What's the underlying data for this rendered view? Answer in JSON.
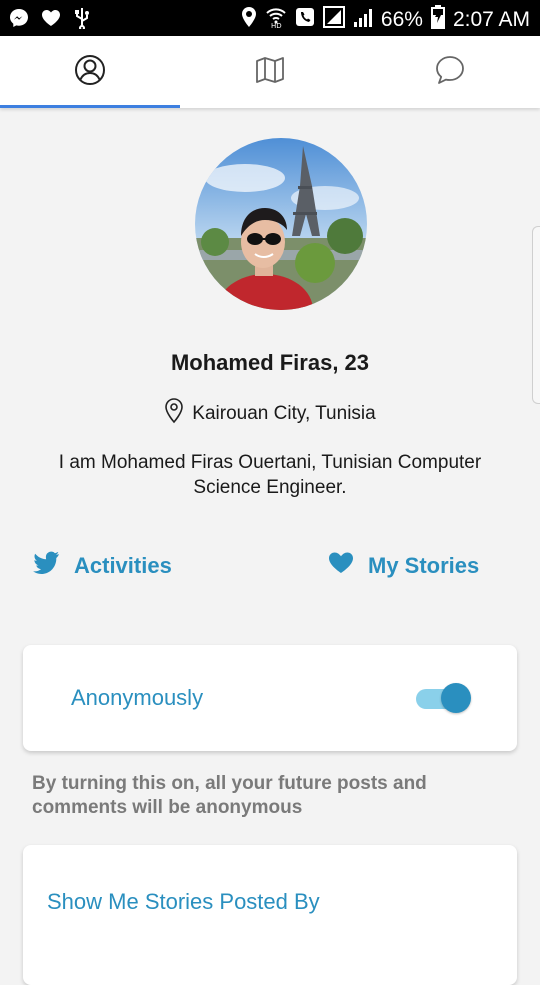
{
  "status_bar": {
    "battery": "66%",
    "time": "2:07 AM",
    "left_icons": [
      "messenger-icon",
      "heart-icon",
      "usb-icon"
    ],
    "right_icons": [
      "location-icon",
      "wifi-calling-icon",
      "phone-icon",
      "signal-icon",
      "signal-bars-icon",
      "battery-icon"
    ]
  },
  "tabs": {
    "items": [
      {
        "icon": "profile-icon",
        "active": true
      },
      {
        "icon": "map-icon",
        "active": false
      },
      {
        "icon": "chat-icon",
        "active": false
      }
    ],
    "active_color": "#3d7fe0"
  },
  "profile": {
    "name": "Mohamed Firas, 23",
    "location": "Kairouan City, Tunisia",
    "bio": "I am Mohamed Firas Ouertani, Tunisian Computer Science Engineer."
  },
  "links": {
    "activities": "Activities",
    "my_stories": "My Stories",
    "accent_color": "#2a8fbf"
  },
  "anonymous_card": {
    "label": "Anonymously",
    "toggle_on": true,
    "helper": "By turning this on, all your future posts and comments will be anonymous"
  },
  "filter_card": {
    "label": "Show Me Stories Posted By"
  }
}
